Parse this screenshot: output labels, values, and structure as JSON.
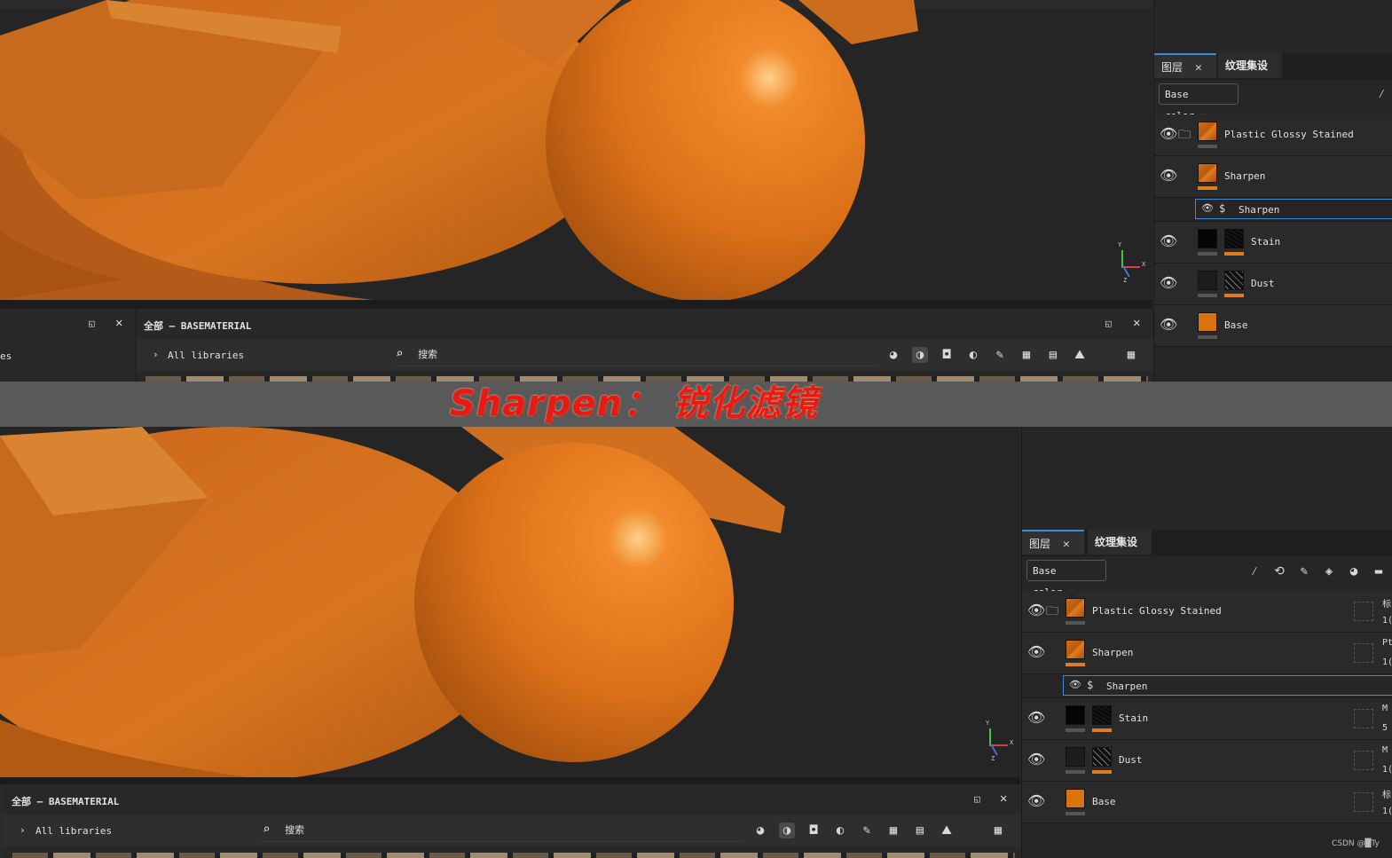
{
  "colors": {
    "accent": "#3d8bd6",
    "brand_orange": "#e07d1f",
    "banner_text": "#e81b14"
  },
  "banner": {
    "text": "Sharpen： 锐化滤镜"
  },
  "top": {
    "left_panel_partial_text": "es",
    "lib_title": "全部 – BASEMATERIAL",
    "all_libraries": "All libraries",
    "search_placeholder": "搜索",
    "layers": {
      "tab_layers": "图层",
      "tab_texture_set": "纹理集设置",
      "channel": "Base color",
      "items": [
        {
          "label": "Plastic Glossy Stained"
        },
        {
          "label": "Sharpen"
        },
        {
          "label": "Sharpen"
        },
        {
          "label": "Stain"
        },
        {
          "label": "Dust"
        },
        {
          "label": "Base"
        }
      ]
    },
    "axis": {
      "y": "Y",
      "x": "X",
      "z": "Z"
    }
  },
  "bottom": {
    "lib_title": "全部 – BASEMATERIAL",
    "all_libraries": "All libraries",
    "search_placeholder": "搜索",
    "layers": {
      "tab_layers": "图层",
      "tab_texture_set": "纹理集设置",
      "channel": "Base color",
      "items": [
        {
          "label": "Plastic Glossy Stained",
          "side_top": "标",
          "side_bottom": "1("
        },
        {
          "label": "Sharpen",
          "side_top": "Pt",
          "side_bottom": "1("
        },
        {
          "label": "Sharpen"
        },
        {
          "label": "Stain",
          "side_top": "M",
          "side_bottom": "5"
        },
        {
          "label": "Dust",
          "side_top": "M",
          "side_bottom": "1("
        },
        {
          "label": "Base",
          "side_top": "标",
          "side_bottom": "1("
        }
      ]
    },
    "axis": {
      "y": "Y",
      "x": "X",
      "z": "Z"
    }
  },
  "watermark": "CSDN @█Ty",
  "icons": {
    "eye": "eye-icon",
    "folder": "folder-icon",
    "filter": "filter-icon",
    "close": "close-icon",
    "maximize": "maximize-icon",
    "search": "search-icon",
    "chevron": "chevron-right-icon",
    "grid": "grid-icon"
  }
}
